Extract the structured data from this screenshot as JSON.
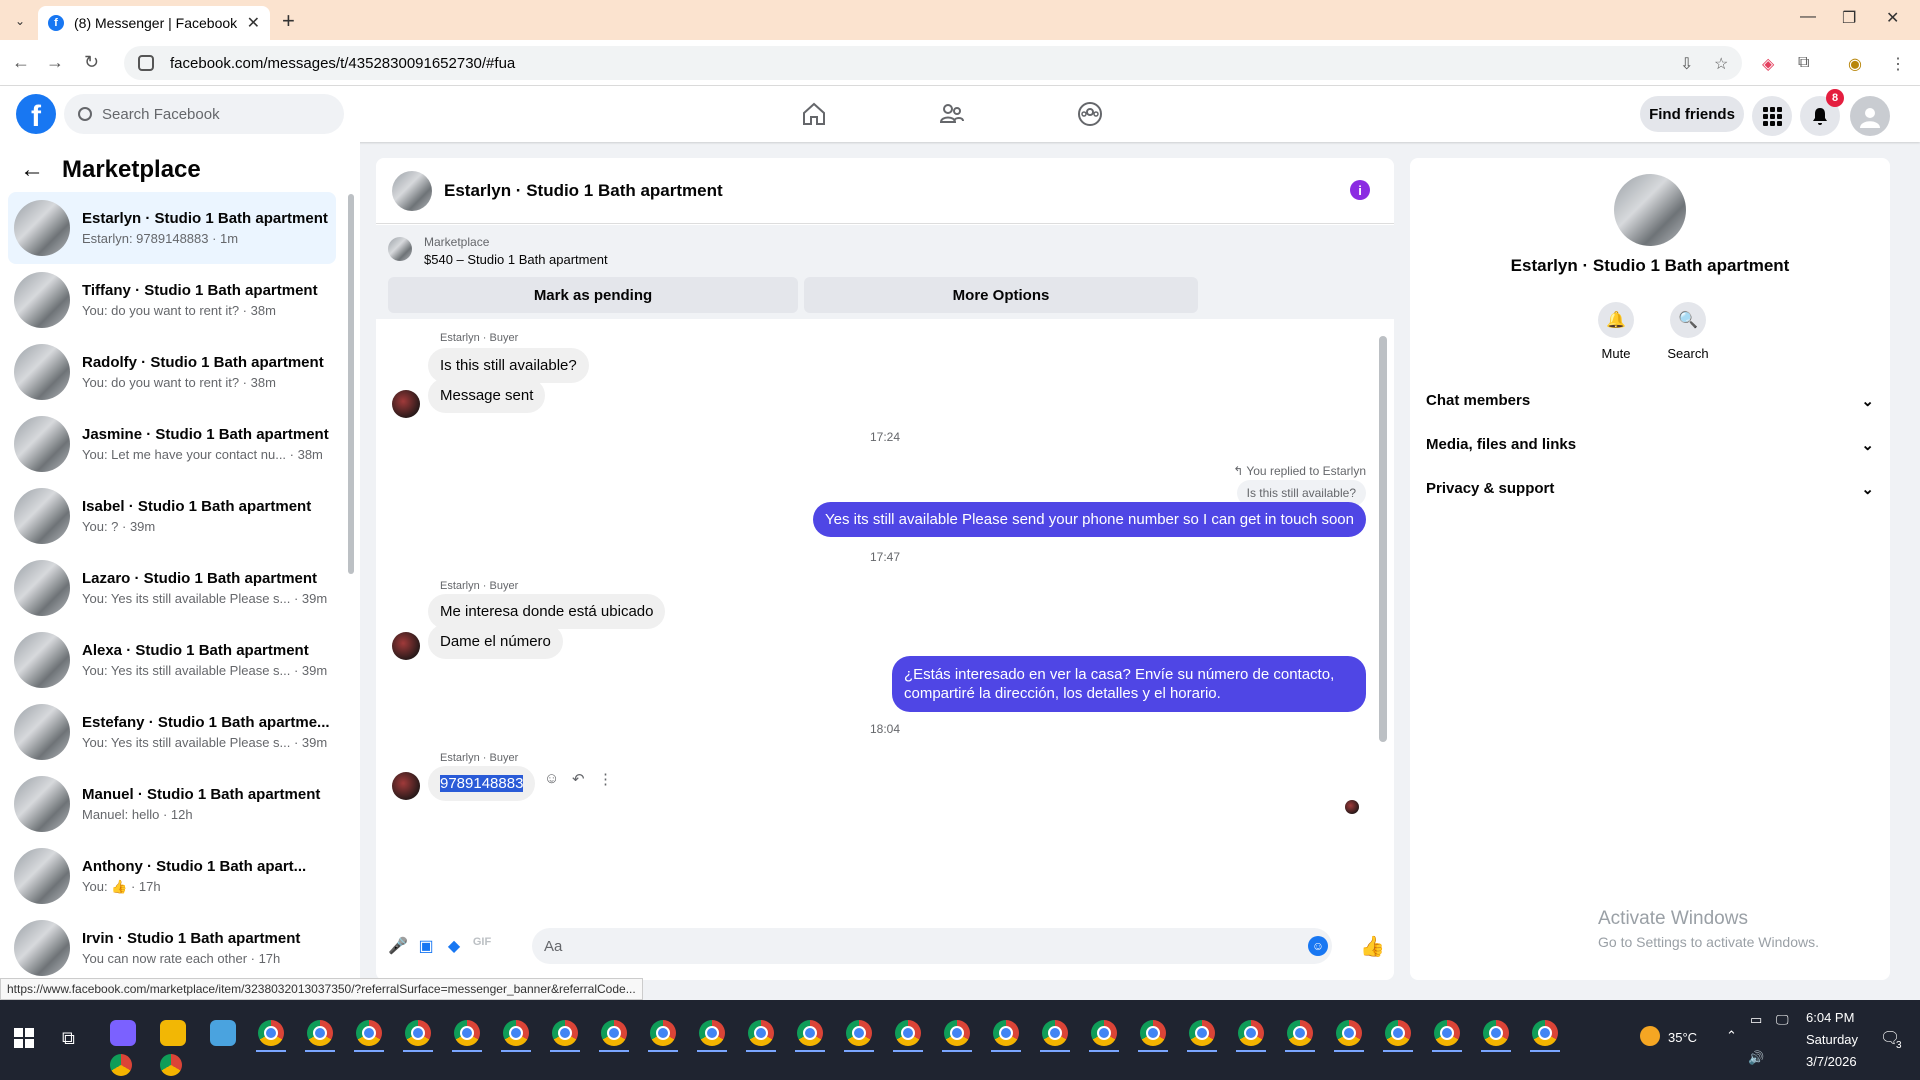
{
  "browser": {
    "tab_title": "(8) Messenger | Facebook",
    "url": "facebook.com/messages/t/4352830091652730/#fua",
    "status_url": "https://www.facebook.com/marketplace/item/3238032013037350/?referralSurface=messenger_banner&referralCode..."
  },
  "fb": {
    "search_placeholder": "Search Facebook",
    "find_friends": "Find friends",
    "notification_count": "8"
  },
  "sidebar": {
    "title": "Marketplace",
    "conversations": [
      {
        "name": "Estarlyn · Studio 1 Bath apartment",
        "snippet": "Estarlyn: 9789148883 · 1m",
        "active": true
      },
      {
        "name": "Tiffany · Studio 1 Bath apartment",
        "snippet": "You: do you want to rent it? · 38m"
      },
      {
        "name": "Radolfy · Studio 1 Bath apartment",
        "snippet": "You: do you want to rent it? · 38m"
      },
      {
        "name": "Jasmine · Studio 1 Bath apartment",
        "snippet": "You: Let me have your contact nu... · 38m"
      },
      {
        "name": "Isabel · Studio 1 Bath apartment",
        "snippet": "You: ? · 39m"
      },
      {
        "name": "Lazaro · Studio 1 Bath apartment",
        "snippet": "You: Yes its still available Please s... · 39m"
      },
      {
        "name": "Alexa · Studio 1 Bath apartment",
        "snippet": "You: Yes its still available Please s... · 39m"
      },
      {
        "name": "Estefany · Studio 1 Bath apartme...",
        "snippet": "You: Yes its still available Please s... · 39m"
      },
      {
        "name": "Manuel · Studio 1 Bath apartment",
        "snippet": "Manuel: hello · 12h"
      },
      {
        "name": "Anthony · Studio 1 Bath apart...",
        "snippet": "You: 👍 · 17h"
      },
      {
        "name": "Irvin · Studio 1 Bath apartment",
        "snippet": "You can now rate each other · 17h"
      }
    ]
  },
  "chat": {
    "title": "Estarlyn · Studio 1 Bath apartment",
    "banner_label": "Marketplace",
    "banner_price": "$540 – Studio 1 Bath apartment",
    "btn_pending": "Mark as pending",
    "btn_more": "More Options",
    "sender_label": "Estarlyn · Buyer",
    "msg1": "Is this still available?",
    "msg2": "Message sent",
    "ts1": "17:24",
    "reply_note": "You replied to Estarlyn",
    "reply_quote": "Is this still available?",
    "out1": "Yes its still available Please send your phone number so I can get in touch soon",
    "ts2": "17:47",
    "msg3": "Me interesa donde está ubicado",
    "msg4": "Dame el número",
    "out2": "¿Estás interesado en ver la casa? Envíe su número de contacto, compartiré la dirección, los detalles y el horario.",
    "ts3": "18:04",
    "msg5": "9789148883",
    "composer_placeholder": "Aa"
  },
  "info": {
    "name": "Estarlyn · Studio 1 Bath apartment",
    "mute": "Mute",
    "search": "Search",
    "rows": [
      "Chat members",
      "Media, files and links",
      "Privacy & support"
    ]
  },
  "windows": {
    "activate_title": "Activate Windows",
    "activate_sub": "Go to Settings to activate Windows.",
    "weather": "35°C",
    "time": "6:04 PM",
    "day": "Saturday",
    "date": "3/7/2026",
    "notif_count": "3"
  },
  "colors": {
    "fb_blue": "#1877f2",
    "outgoing_bubble": "#4f46e5",
    "active_conv": "#ebf5ff"
  }
}
